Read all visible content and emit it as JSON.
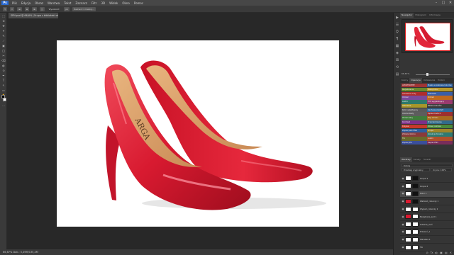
{
  "app": {
    "logo": "Ps"
  },
  "menu": [
    "Plik",
    "Edycja",
    "Obraz",
    "Warstwa",
    "Tekst",
    "Zaznacz",
    "Filtr",
    "3D",
    "Widok",
    "Okno",
    "Pomoc"
  ],
  "window_controls": [
    "–",
    "□",
    "✕"
  ],
  "options_bar": {
    "items": [
      "⚲",
      "▾",
      "⊞",
      "⊟",
      "⊠",
      "◫",
      "Wysokość:",
      "px",
      "Zaznacz i maskuj..."
    ]
  },
  "document": {
    "tab_title": "SPN.psd @ 66,6% (Grupa z biblioteki obiektów, RGB/8) *",
    "status": "66,67%   Dok.: 5,49M/135,4M"
  },
  "tools": [
    "⬚",
    "⊕",
    "✥",
    "⌖",
    "✎",
    "⟋",
    "▣",
    "◯",
    "✂",
    "⌫",
    "◐",
    "⊙",
    "✒",
    "T",
    "↖",
    "▭",
    "✋",
    "⚲",
    "…"
  ],
  "icon_strip": [
    "▶",
    "☰",
    "⛭",
    "¶",
    "▦",
    "◈",
    "⊞",
    "⟲",
    "▤"
  ],
  "navigator": {
    "tabs": [
      "Nawigator",
      "Histogram",
      "Informacje"
    ],
    "zoom": "66,67%"
  },
  "actions": {
    "tabs": [
      "Kolory",
      "Operacje",
      "Ustawienia",
      "Próbki"
    ],
    "rows": [
      [
        "APOSTROPHE",
        "Maska w zakresie kolorów"
      ],
      [
        "Rozjaśnianie",
        "Nadaj kolor"
      ],
      [
        "Czerwone oczy",
        "Niebieski"
      ],
      [
        "Odcień",
        "Odcień"
      ],
      [
        "Lustro",
        "Filtr wygładzający"
      ],
      [
        "Ostrzenie",
        "Balans kolorów"
      ],
      [
        "Kolor selektywny",
        "Zachowaj kształt"
      ],
      [
        "Czarno-biały",
        "Pędzel historii"
      ],
      [
        "Obraz ostry",
        "Styl obrazu"
      ],
      [
        "Kontrast",
        "Przyciemnianie"
      ],
      [
        "Krzywe",
        "Zmień rozmiar"
      ],
      [
        "Zapisz jako PNG",
        "Grupa"
      ],
      [
        "Zmiana koloru",
        "Korekcja tonalna"
      ],
      [
        "Tło",
        "Lustro"
      ],
      [
        "Zapisz JPG",
        "Zapisz PSD"
      ]
    ],
    "row_colors": [
      [
        "#a03535",
        "#2e5f9c"
      ],
      [
        "#6b8a2d",
        "#b89a2a"
      ],
      [
        "#b02c2c",
        "#3a5ea8"
      ],
      [
        "#7a4a9c",
        "#c0691e"
      ],
      [
        "#2f7a6a",
        "#9a3b6e"
      ],
      [
        "#a8962a",
        "#3d3d3d"
      ],
      [
        "#5a5a5a",
        "#2e6aa0"
      ],
      [
        "#5d5d5d",
        "#9c3030"
      ],
      [
        "#3f7c3a",
        "#a86a20"
      ],
      [
        "#7d2f8a",
        "#316b8c"
      ],
      [
        "#c6382a",
        "#4a8a3a"
      ],
      [
        "#2d5e9e",
        "#a0862a"
      ],
      [
        "#8a3a3a",
        "#2e7a72"
      ],
      [
        "#6a6a2a",
        "#b0502a"
      ],
      [
        "#3a4f9c",
        "#7a2d5a"
      ]
    ]
  },
  "layers": {
    "tabs": [
      "Warstwy",
      "Kanały",
      "Ścieżki"
    ],
    "filter": "Rodzaj",
    "blend": "Przebieg oryginalny",
    "opacity": "Krycie: 100%",
    "items": [
      {
        "name": "Grupa 1",
        "selected": false
      },
      {
        "name": "Grupa 2",
        "selected": false
      },
      {
        "name": "Kolor 1",
        "selected": true
      },
      {
        "name": "Wartość_roboczy 1",
        "selected": false
      },
      {
        "name": "Wypełn_roboczy 1",
        "selected": false
      },
      {
        "name": "Bezgłowie_pod 1",
        "selected": false
      },
      {
        "name": "Odbicie_cień",
        "selected": false
      },
      {
        "name": "Przesuń_1",
        "selected": false
      },
      {
        "name": "Warstwa 1",
        "selected": false
      },
      {
        "name": "Tło",
        "selected": false
      }
    ],
    "footer_icons": [
      "⊘",
      "fx",
      "◐",
      "▣",
      "▤",
      "✕"
    ]
  }
}
